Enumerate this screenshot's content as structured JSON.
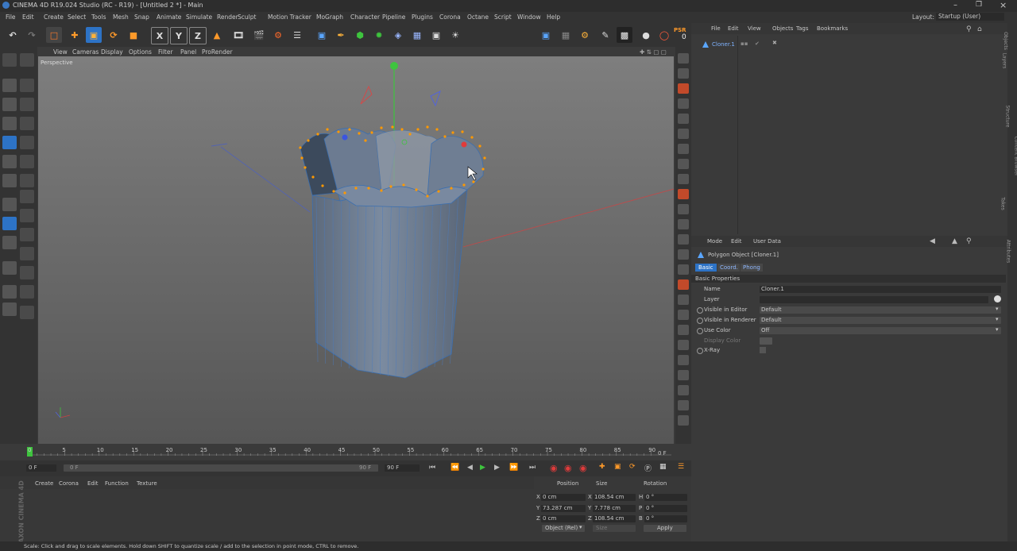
{
  "window": {
    "title": "CINEMA 4D R19.024 Studio (RC - R19) - [Untitled 2 *] - Main",
    "layout_label": "Layout:",
    "layout_value": "Startup (User)"
  },
  "menu": [
    "File",
    "Edit",
    "Create",
    "Select",
    "Tools",
    "Mesh",
    "Snap",
    "Animate",
    "Simulate",
    "Render",
    "Sculpt",
    "Motion Tracker",
    "MoGraph",
    "Character",
    "Pipeline",
    "Plugins",
    "Corona",
    "Octane",
    "Script",
    "Window",
    "Help"
  ],
  "toolbar": {
    "x": "X",
    "y": "Y",
    "z": "Z",
    "psr": "PSR",
    "psr_value": "0"
  },
  "viewport": {
    "menu": [
      "View",
      "Cameras",
      "Display",
      "Options",
      "Filter",
      "Panel",
      "ProRender"
    ],
    "label": "Perspective"
  },
  "timeline": {
    "ticks": [
      "0",
      "5",
      "10",
      "15",
      "20",
      "25",
      "30",
      "35",
      "40",
      "45",
      "50",
      "55",
      "60",
      "65",
      "70",
      "75",
      "80",
      "85",
      "90"
    ],
    "end_label": "0 F",
    "current_frame": "0 F",
    "start_field": "0 F",
    "range_end": "90 F",
    "max_field": "90 F"
  },
  "material_manager": {
    "menu": [
      "Create",
      "Corona",
      "Edit",
      "Function",
      "Texture"
    ]
  },
  "coords": {
    "headers": [
      "Position",
      "Size",
      "Rotation"
    ],
    "rows": [
      {
        "axis": "X",
        "pos": "0 cm",
        "size_axis": "X",
        "size": "108.54 cm",
        "rot_axis": "H",
        "rot": "0 °"
      },
      {
        "axis": "Y",
        "pos": "73.287 cm",
        "size_axis": "Y",
        "size": "7.778 cm",
        "rot_axis": "P",
        "rot": "0 °"
      },
      {
        "axis": "Z",
        "pos": "0 cm",
        "size_axis": "Z",
        "size": "108.54 cm",
        "rot_axis": "B",
        "rot": "0 °"
      }
    ],
    "mode_dropdown": "Object (Rel)",
    "size_dropdown": "Size",
    "apply_label": "Apply"
  },
  "object_manager": {
    "menu": [
      "File",
      "Edit",
      "View",
      "Objects",
      "Tags",
      "Bookmarks"
    ],
    "objects": [
      "Cloner.1"
    ]
  },
  "attribute_manager": {
    "menu": [
      "Mode",
      "Edit",
      "User Data"
    ],
    "object_title": "Polygon Object [Cloner.1]",
    "tabs": [
      "Basic",
      "Coord.",
      "Phong"
    ],
    "section": "Basic Properties",
    "props": [
      {
        "label": "Name",
        "value": "Cloner.1"
      },
      {
        "label": "Layer",
        "value": ""
      },
      {
        "label": "Visible in Editor",
        "value": "Default"
      },
      {
        "label": "Visible in Renderer",
        "value": "Default"
      },
      {
        "label": "Use Color",
        "value": "Off"
      },
      {
        "label": "Display Color",
        "value": ""
      },
      {
        "label": "X-Ray",
        "value": ""
      }
    ]
  },
  "side_tabs": [
    "Attributes",
    "Layers",
    "Structure",
    "Content Browser",
    "Takes",
    "Objects"
  ],
  "status": "Scale: Click and drag to scale elements. Hold down SHIFT to quantize scale / add to the selection in point mode, CTRL to remove.",
  "brand": "MAXON CINEMA 4D",
  "colors": {
    "accent": "#2d73c6",
    "mesh": "#5f7fa4",
    "selection_point": "#ff9900",
    "x_axis": "#c94242",
    "y_axis": "#3ec43e",
    "z_axis": "#4f6bd6"
  }
}
